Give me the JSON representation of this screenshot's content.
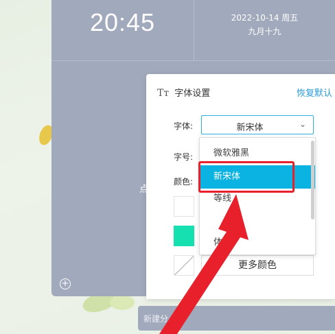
{
  "clock": {
    "time": "20:45",
    "date": "2022-10-14  周五",
    "lunar": "九月十九"
  },
  "panel": {
    "add_icon": "plus-circle-icon",
    "side_text": "点"
  },
  "font_settings": {
    "title": "字体设置",
    "title_icon": "Tт",
    "reset_label": "恢复默认",
    "font_label": "字体:",
    "font_value": "新宋体",
    "size_label": "字号:",
    "color_label": "颜色:",
    "more_colors_label": "更多颜色",
    "swatches": [
      "#ffffff",
      "#16dfb0",
      "none"
    ]
  },
  "font_dropdown": {
    "items": [
      "微软雅黑",
      "新宋体",
      "等线",
      "",
      "体"
    ],
    "selected": "新宋体"
  },
  "new_group": {
    "label": "新建分"
  },
  "colors": {
    "accent": "#0ab3e1",
    "highlight": "#e8202c",
    "panel": "#a1a9bc",
    "link": "#2b9bd8"
  }
}
